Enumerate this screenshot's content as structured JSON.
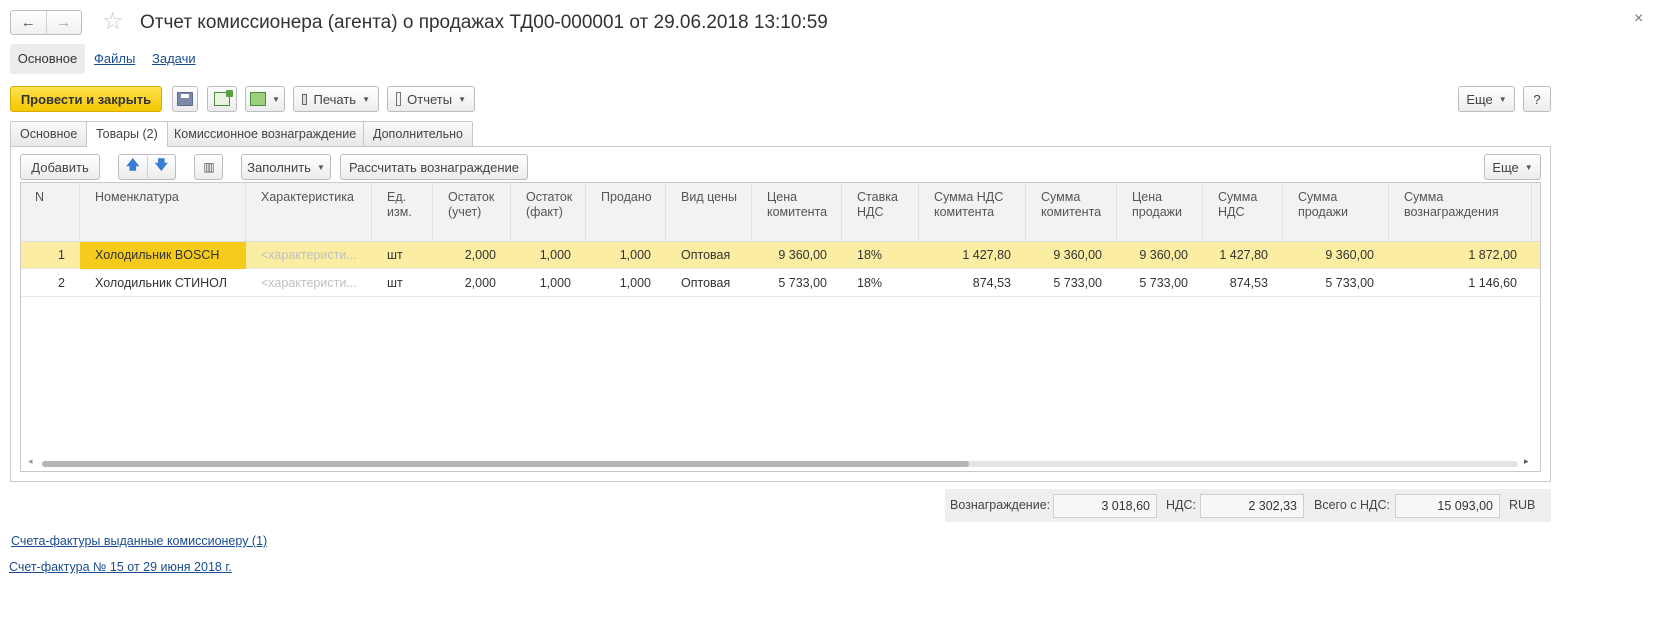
{
  "window": {
    "title": "Отчет комиссионера (агента) о продажах ТД00-000001 от 29.06.2018 13:10:59",
    "back_icon": "←",
    "forward_icon": "→",
    "star_icon": "☆",
    "close_icon": "×"
  },
  "sections": {
    "main": "Основное",
    "files": "Файлы",
    "tasks": "Задачи"
  },
  "toolbar": {
    "post_close": "Провести и закрыть",
    "print": "Печать",
    "reports": "Отчеты",
    "more": "Еще",
    "help": "?"
  },
  "tabs": {
    "items": [
      "Основное",
      "Товары (2)",
      "Комиссионное вознаграждение",
      "Дополнительно"
    ],
    "active_index": 1
  },
  "table_toolbar": {
    "add": "Добавить",
    "fill": "Заполнить",
    "calc": "Рассчитать вознаграждение",
    "more": "Еще"
  },
  "table": {
    "headers": [
      [
        "N"
      ],
      [
        "Номенклатура"
      ],
      [
        "Характеристика"
      ],
      [
        "Ед.",
        "изм."
      ],
      [
        "Остаток",
        "(учет)"
      ],
      [
        "Остаток",
        "(факт)"
      ],
      [
        "Продано"
      ],
      [
        "Вид цены"
      ],
      [
        "Цена",
        "комитента"
      ],
      [
        "Ставка",
        "НДС"
      ],
      [
        "Сумма НДС",
        "комитента"
      ],
      [
        "Сумма",
        "комитента"
      ],
      [
        "Цена",
        "продажи"
      ],
      [
        "Сумма",
        "НДС"
      ],
      [
        "Сумма",
        "продажи"
      ],
      [
        "Сумма",
        "вознаграждения"
      ]
    ],
    "rows": [
      [
        "1",
        "Холодильник BOSCH",
        "<характеристи...",
        "шт",
        "2,000",
        "1,000",
        "1,000",
        "Оптовая",
        "9 360,00",
        "18%",
        "1 427,80",
        "9 360,00",
        "9 360,00",
        "1 427,80",
        "9 360,00",
        "1 872,00"
      ],
      [
        "2",
        "Холодильник СТИНОЛ",
        "<характеристи...",
        "шт",
        "2,000",
        "1,000",
        "1,000",
        "Оптовая",
        "5 733,00",
        "18%",
        "874,53",
        "5 733,00",
        "5 733,00",
        "874,53",
        "5 733,00",
        "1 146,60"
      ]
    ],
    "selected_row": 0
  },
  "totals": {
    "reward_label": "Вознаграждение:",
    "reward_value": "3 018,60",
    "vat_label": "НДС:",
    "vat_value": "2 302,33",
    "total_label": "Всего с НДС:",
    "total_value": "15 093,00",
    "currency": "RUB"
  },
  "links": {
    "invoices_issued": "Счета-фактуры выданные комиссионеру (1)",
    "invoice": "Счет-фактура  № 15 от 29 июня 2018 г."
  }
}
